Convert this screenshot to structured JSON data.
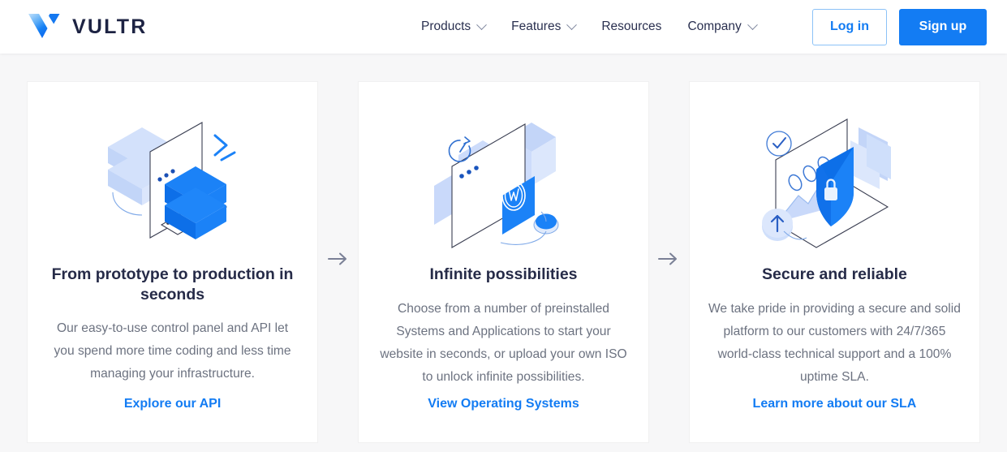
{
  "header": {
    "logo_icon": "vultr-v-logo-icon",
    "brand_name": "VULTR",
    "nav": [
      {
        "label": "Products",
        "has_chevron": true,
        "icon": "chevron-down-icon"
      },
      {
        "label": "Features",
        "has_chevron": true,
        "icon": "chevron-down-icon"
      },
      {
        "label": "Resources",
        "has_chevron": false,
        "icon": ""
      },
      {
        "label": "Company",
        "has_chevron": true,
        "icon": "chevron-down-icon"
      }
    ],
    "login_label": "Log in",
    "signup_label": "Sign up"
  },
  "separators": {
    "arrow_icon": "arrow-right-icon",
    "arrow_glyph": "→"
  },
  "cards": [
    {
      "illustration": "server-stack-terminal-isometric-illustration",
      "title": "From prototype to production in seconds",
      "body": "Our easy-to-use control panel and API let you spend more time coding and less time managing your infrastructure.",
      "link": "Explore our API"
    },
    {
      "illustration": "browser-wordpress-isometric-illustration",
      "title": "Infinite possibilities",
      "body": "Choose from a number of preinstalled Systems and Applications to start your website in seconds, or upload your own ISO to unlock infinite possibilities.",
      "link": "View Operating Systems"
    },
    {
      "illustration": "shield-lock-dashboard-isometric-illustration",
      "title": "Secure and reliable",
      "body": "We take pride in providing a secure and solid platform to our customers with 24/7/365 world-class technical support and a 100% uptime SLA.",
      "link": "Learn more about our SLA"
    }
  ],
  "colors": {
    "brand_blue": "#137cf3",
    "light_blue": "#c3d5f8",
    "pale_blue": "#dde7fb",
    "title_navy": "#262b48",
    "body_gray": "#6c7280",
    "page_bg": "#f7f7f8",
    "card_bg": "#ffffff"
  }
}
